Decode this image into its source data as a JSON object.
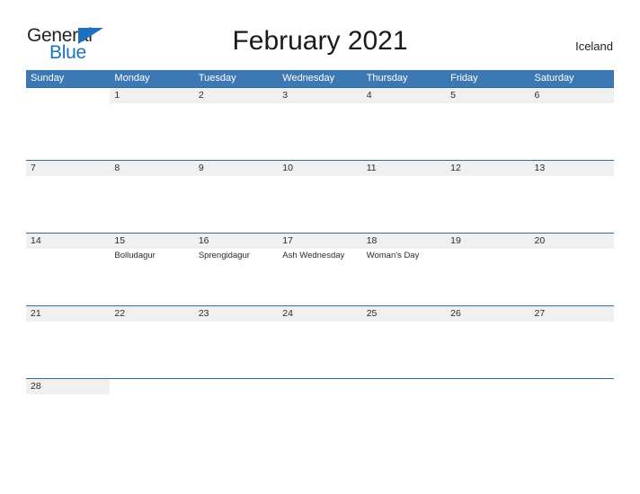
{
  "branding": {
    "logo_text_primary": "General",
    "logo_text_secondary": "Blue",
    "flag_icon": "triangle-flag-icon"
  },
  "header": {
    "title": "February 2021",
    "locale": "Iceland"
  },
  "colors": {
    "header_blue": "#3c78b4",
    "rule_blue": "#2e6da4",
    "date_band_gray": "#f0f0f0",
    "logo_blue": "#1d72bd",
    "text_dark": "#2b2b2b"
  },
  "calendar": {
    "weekdays": [
      "Sunday",
      "Monday",
      "Tuesday",
      "Wednesday",
      "Thursday",
      "Friday",
      "Saturday"
    ],
    "weeks": [
      [
        {
          "date": "",
          "event": ""
        },
        {
          "date": "1",
          "event": ""
        },
        {
          "date": "2",
          "event": ""
        },
        {
          "date": "3",
          "event": ""
        },
        {
          "date": "4",
          "event": ""
        },
        {
          "date": "5",
          "event": ""
        },
        {
          "date": "6",
          "event": ""
        }
      ],
      [
        {
          "date": "7",
          "event": ""
        },
        {
          "date": "8",
          "event": ""
        },
        {
          "date": "9",
          "event": ""
        },
        {
          "date": "10",
          "event": ""
        },
        {
          "date": "11",
          "event": ""
        },
        {
          "date": "12",
          "event": ""
        },
        {
          "date": "13",
          "event": ""
        }
      ],
      [
        {
          "date": "14",
          "event": ""
        },
        {
          "date": "15",
          "event": "Bolludagur"
        },
        {
          "date": "16",
          "event": "Sprengidagur"
        },
        {
          "date": "17",
          "event": "Ash Wednesday"
        },
        {
          "date": "18",
          "event": "Woman's Day"
        },
        {
          "date": "19",
          "event": ""
        },
        {
          "date": "20",
          "event": ""
        }
      ],
      [
        {
          "date": "21",
          "event": ""
        },
        {
          "date": "22",
          "event": ""
        },
        {
          "date": "23",
          "event": ""
        },
        {
          "date": "24",
          "event": ""
        },
        {
          "date": "25",
          "event": ""
        },
        {
          "date": "26",
          "event": ""
        },
        {
          "date": "27",
          "event": ""
        }
      ],
      [
        {
          "date": "28",
          "event": ""
        },
        {
          "date": "",
          "event": ""
        },
        {
          "date": "",
          "event": ""
        },
        {
          "date": "",
          "event": ""
        },
        {
          "date": "",
          "event": ""
        },
        {
          "date": "",
          "event": ""
        },
        {
          "date": "",
          "event": ""
        }
      ]
    ]
  }
}
